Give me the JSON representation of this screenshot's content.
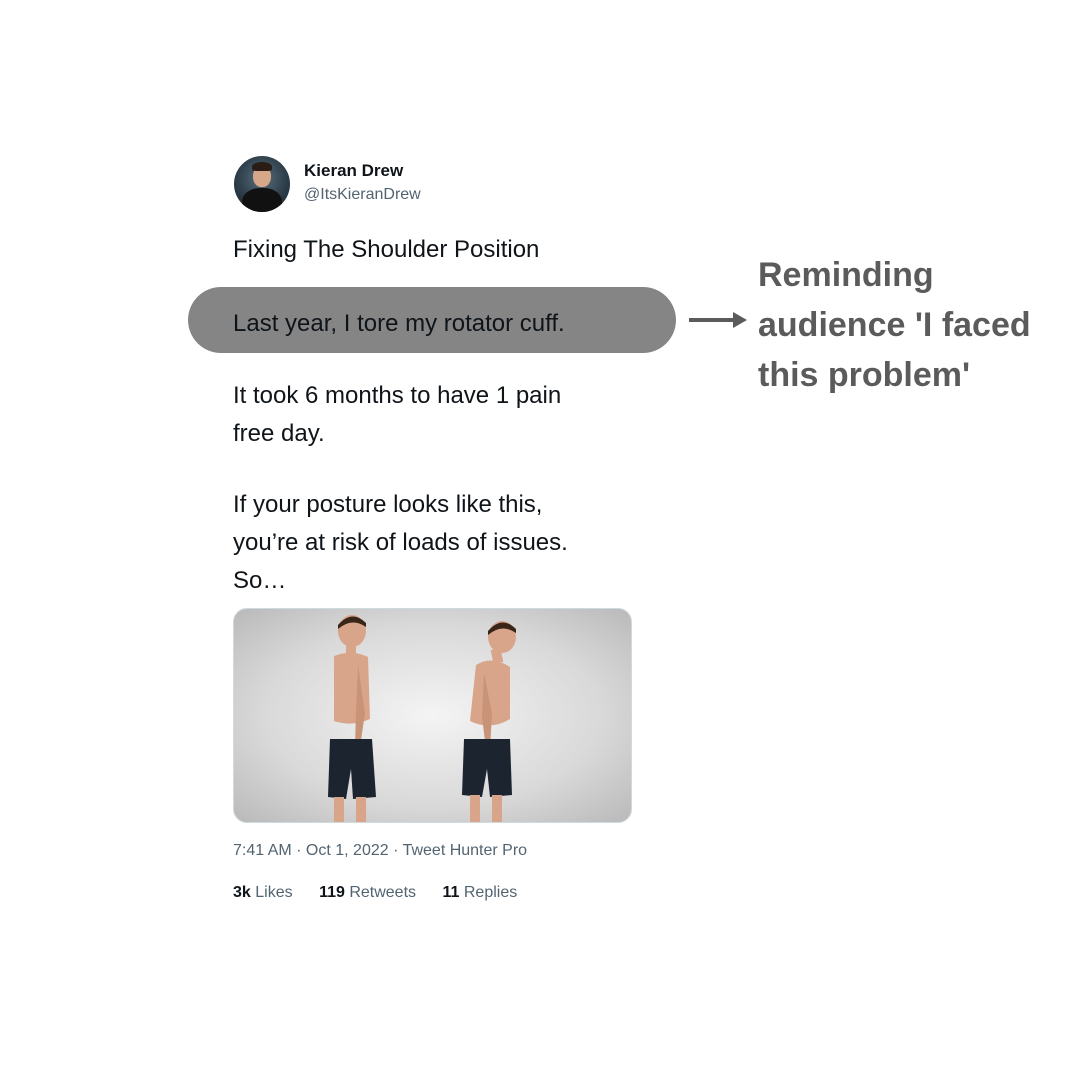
{
  "author": {
    "name": "Kieran Drew",
    "handle": "@ItsKieranDrew"
  },
  "tweet": {
    "title": "Fixing The Shoulder Position",
    "highlighted_line": "Last year, I tore my rotator cuff.",
    "paragraph2": [
      "It took 6 months to have 1 pain",
      "free day."
    ],
    "paragraph3": [
      "If your posture looks like this,",
      "you’re at risk of loads of issues.",
      "So…"
    ]
  },
  "annotation": {
    "lines": [
      "Reminding",
      "audience 'I faced",
      "this problem'"
    ]
  },
  "meta": {
    "timestamp": "7:41 AM · Oct 1, 2022 · Tweet Hunter Pro"
  },
  "stats": {
    "likes_count": "3k",
    "likes_label": "Likes",
    "retweets_count": "119",
    "retweets_label": "Retweets",
    "replies_count": "11",
    "replies_label": "Replies"
  },
  "colors": {
    "highlight": "#858585",
    "annotation": "#5b5b5b",
    "muted_text": "#536471"
  }
}
